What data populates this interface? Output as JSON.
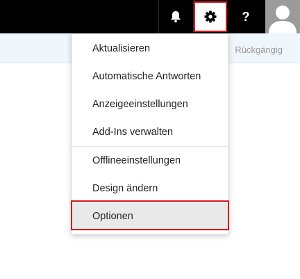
{
  "topbar": {
    "icons": [
      "bell-icon",
      "gear-icon",
      "help-icon",
      "avatar-icon"
    ],
    "help_label": "?"
  },
  "commandbar": {
    "undo_label": "Rückgängig"
  },
  "settings_menu": {
    "items": [
      {
        "label": "Aktualisieren"
      },
      {
        "label": "Automatische Antworten"
      },
      {
        "label": "Anzeigeeinstellungen"
      },
      {
        "label": "Add-Ins verwalten"
      },
      {
        "label": "Offlineeinstellungen"
      },
      {
        "label": "Design ändern"
      },
      {
        "label": "Optionen",
        "selected": true
      }
    ]
  },
  "colors": {
    "topbar": "#000000",
    "highlight": "#d9141c",
    "commandbar": "#eff6fc"
  }
}
